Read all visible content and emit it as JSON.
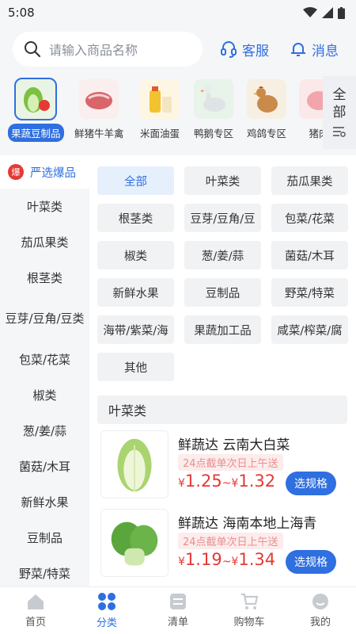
{
  "status": {
    "time": "5:08"
  },
  "search": {
    "placeholder": "请输入商品名称"
  },
  "actions": {
    "service": "客服",
    "messages": "消息"
  },
  "categories": [
    {
      "label": "果蔬豆制品",
      "active": true
    },
    {
      "label": "鲜猪牛羊禽",
      "active": false
    },
    {
      "label": "米面油蛋",
      "active": false
    },
    {
      "label": "鸭鹅专区",
      "active": false
    },
    {
      "label": "鸡鸽专区",
      "active": false
    },
    {
      "label": "猪肉",
      "active": false
    }
  ],
  "all_button": {
    "line1": "全",
    "line2": "部"
  },
  "sidebar": {
    "hot": "严选爆品",
    "hot_badge": "爆",
    "items": [
      "叶菜类",
      "茄瓜果类",
      "根茎类",
      "豆芽/豆角/豆类",
      "包菜/花菜",
      "椒类",
      "葱/姜/蒜",
      "菌菇/木耳",
      "新鲜水果",
      "豆制品",
      "野菜/特菜"
    ]
  },
  "chips": [
    "全部",
    "叶菜类",
    "茄瓜果类",
    "根茎类",
    "豆芽/豆角/豆",
    "包菜/花菜",
    "椒类",
    "葱/姜/蒜",
    "菌菇/木耳",
    "新鲜水果",
    "豆制品",
    "野菜/特菜",
    "海带/紫菜/海",
    "果蔬加工品",
    "咸菜/榨菜/腐",
    "其他"
  ],
  "section_title": "叶菜类",
  "products": [
    {
      "name": "鲜蔬达 云南大白菜",
      "note": "24点截单次日上午送",
      "currency": "¥",
      "price_low": "1.25",
      "price_high": "1.32",
      "sep": "~",
      "spec_label": "选规格"
    },
    {
      "name": "鲜蔬达 海南本地上海青",
      "note": "24点截单次日上午送",
      "currency": "¥",
      "price_low": "1.19",
      "price_high": "1.34",
      "sep": "~",
      "spec_label": "选规格"
    }
  ],
  "tabs": [
    {
      "label": "首页",
      "icon": "home-icon",
      "active": false
    },
    {
      "label": "分类",
      "icon": "category-icon",
      "active": true
    },
    {
      "label": "清单",
      "icon": "list-icon",
      "active": false
    },
    {
      "label": "购物车",
      "icon": "cart-icon",
      "active": false
    },
    {
      "label": "我的",
      "icon": "profile-icon",
      "active": false
    }
  ],
  "colors": {
    "accent": "#2f6fe0",
    "price": "#e53935",
    "note_bg": "#fdecec"
  }
}
